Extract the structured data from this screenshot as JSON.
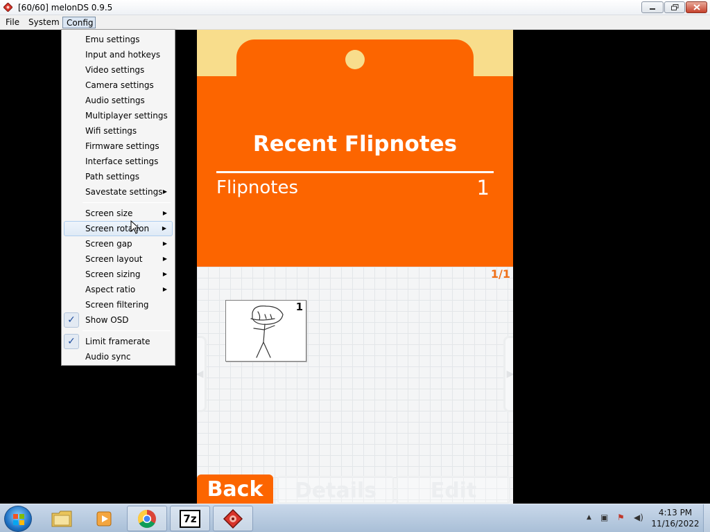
{
  "window": {
    "title": "[60/60] melonDS 0.9.5"
  },
  "menubar": {
    "file": "File",
    "system": "System",
    "config": "Config"
  },
  "config_menu": {
    "emu_settings": "Emu settings",
    "input_hotkeys": "Input and hotkeys",
    "video_settings": "Video settings",
    "camera_settings": "Camera settings",
    "audio_settings": "Audio settings",
    "multiplayer_settings": "Multiplayer settings",
    "wifi_settings": "Wifi settings",
    "firmware_settings": "Firmware settings",
    "interface_settings": "Interface settings",
    "path_settings": "Path settings",
    "savestate_settings": "Savestate settings",
    "screen_size": "Screen size",
    "screen_rotation": "Screen rotation",
    "screen_gap": "Screen gap",
    "screen_layout": "Screen layout",
    "screen_sizing": "Screen sizing",
    "aspect_ratio": "Aspect ratio",
    "screen_filtering": "Screen filtering",
    "show_osd": "Show OSD",
    "limit_framerate": "Limit framerate",
    "audio_sync": "Audio sync",
    "checked": [
      "Show OSD",
      "Limit framerate"
    ],
    "hovered": "Screen rotation"
  },
  "ds_top": {
    "title": "Recent Flipnotes",
    "label": "Flipnotes",
    "count": "1"
  },
  "ds_bottom": {
    "page_indicator": "1/1",
    "thumbnail_number": "1",
    "back": "Back",
    "details": "Details",
    "edit": "Edit"
  },
  "taskbar": {
    "time": "4:13 PM",
    "date": "11/16/2022",
    "seven_zip": "7z"
  },
  "colors": {
    "flipnote_orange": "#fc6500",
    "flipnote_cream": "#f8dd8c"
  }
}
